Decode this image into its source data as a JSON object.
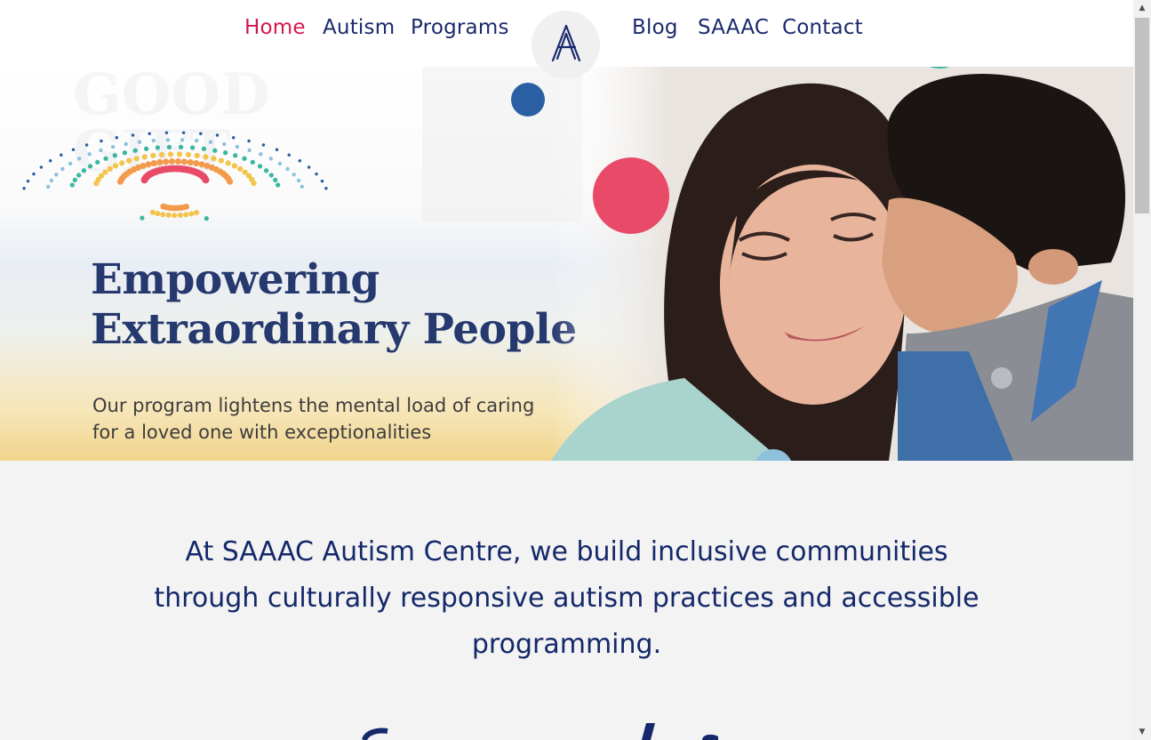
{
  "nav": {
    "items": [
      {
        "label": "Home",
        "active": true
      },
      {
        "label": "Autism"
      },
      {
        "label": "Programs"
      },
      {
        "label": "Blog"
      },
      {
        "label": "SAAAC"
      },
      {
        "label": "Contact"
      }
    ],
    "logo_icon": "saaac-a-logo-icon"
  },
  "hero": {
    "title_line1": "Empowering",
    "title_line2": "Extraordinary People",
    "subtitle_line1": "Our program lightens the mental load of caring",
    "subtitle_line2": "for a loved one with exceptionalities"
  },
  "intro": {
    "text": "At SAAAC Autism Centre, we build inclusive communities through culturally responsive autism practices and accessible programming."
  },
  "colors": {
    "navy": "#1a2a6c",
    "accent_pink": "#d3174f",
    "hero_title": "#26396f",
    "dot_red": "#e84a68",
    "dot_blue": "#2b5fa3",
    "dot_lightblue": "#8ec1dc",
    "dot_teal": "#3bb8a0"
  }
}
